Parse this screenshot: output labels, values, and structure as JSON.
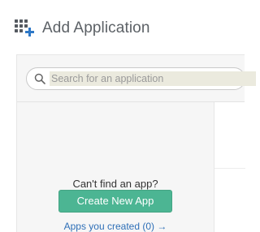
{
  "header": {
    "icon": "app-grid-plus-icon",
    "title": "Add Application"
  },
  "search": {
    "icon": "search-icon",
    "placeholder": "Search for an application",
    "value": ""
  },
  "empty_state": {
    "message": "Can't find an app?",
    "create_button_label": "Create New App",
    "apps_created_link": "Apps you created (0) →"
  },
  "colors": {
    "accent_button": "#4cb593",
    "link": "#2e6fb7",
    "icon_plus": "#2e78c7"
  }
}
